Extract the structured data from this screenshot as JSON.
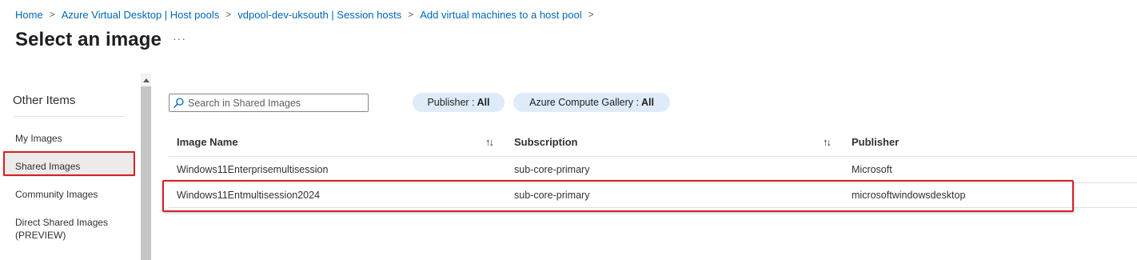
{
  "breadcrumb": {
    "items": [
      "Home",
      "Azure Virtual Desktop | Host pools",
      "vdpool-dev-uksouth | Session hosts",
      "Add virtual machines to a host pool"
    ],
    "separator": ">"
  },
  "page": {
    "title": "Select an image",
    "more_label": "···"
  },
  "nav": {
    "title": "Other Items",
    "items": [
      {
        "label": "My Images"
      },
      {
        "label": "Shared Images",
        "selected": true
      },
      {
        "label": "Community Images"
      },
      {
        "label": "Direct Shared Images (PREVIEW)"
      }
    ]
  },
  "search": {
    "placeholder": "Search in Shared Images",
    "value": ""
  },
  "filters": {
    "publisher": {
      "label": "Publisher :",
      "value": "All"
    },
    "gallery": {
      "label": "Azure Compute Gallery :",
      "value": "All"
    }
  },
  "table": {
    "columns": [
      "Image Name",
      "Subscription",
      "Publisher"
    ],
    "sort_glyph": "↑↓",
    "rows": [
      {
        "name": "Windows11Enterprisemultisession",
        "subscription": "sub-core-primary",
        "publisher": "Microsoft"
      },
      {
        "name": "Windows11Entmultisession2024",
        "subscription": "sub-core-primary",
        "publisher": "microsoftwindowsdesktop",
        "highlighted": true
      }
    ]
  },
  "colors": {
    "link": "#0067b8",
    "highlight": "#d41f27",
    "pill": "#deecf9",
    "selected_bg": "#edebe9"
  }
}
